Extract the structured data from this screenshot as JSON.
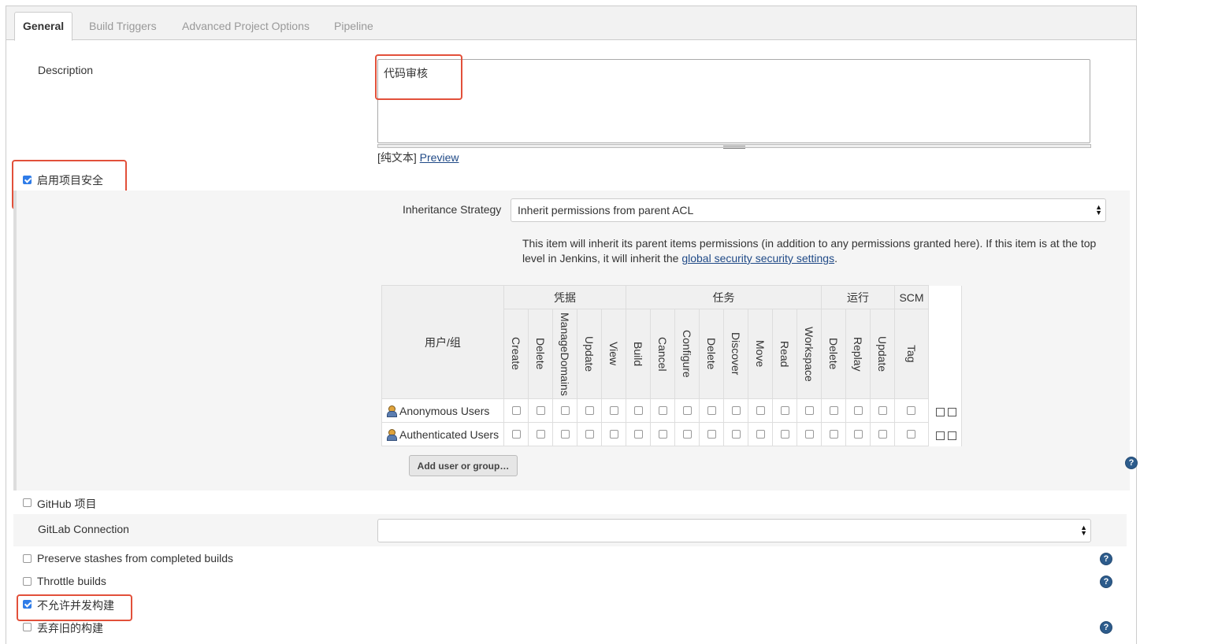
{
  "tabs": [
    {
      "label": "General",
      "active": true
    },
    {
      "label": "Build Triggers",
      "active": false
    },
    {
      "label": "Advanced Project Options",
      "active": false
    },
    {
      "label": "Pipeline",
      "active": false
    }
  ],
  "description": {
    "label": "Description",
    "value": "代码审核",
    "plain_text_label": "[纯文本]",
    "preview_link": "Preview"
  },
  "project_security": {
    "label": "启用项目安全",
    "checked": true,
    "inheritance_label": "Inheritance Strategy",
    "inheritance_value": "Inherit permissions from parent ACL",
    "help_text_1": "This item will inherit its parent items permissions (in addition to any permissions granted here). If this item is at the top",
    "help_text_2": "level in Jenkins, it will inherit the",
    "help_link": "global security security settings",
    "help_text_end": "."
  },
  "matrix": {
    "user_header": "用户/组",
    "groups": [
      {
        "name": "凭据"
      },
      {
        "name": "任务"
      },
      {
        "name": "运行"
      },
      {
        "name": "SCM"
      }
    ],
    "columns": [
      "Create",
      "Delete",
      "ManageDomains",
      "Update",
      "View",
      "Build",
      "Cancel",
      "Configure",
      "Delete",
      "Discover",
      "Move",
      "Read",
      "Workspace",
      "Delete",
      "Replay",
      "Update",
      "Tag"
    ],
    "rows": [
      {
        "name": "Anonymous Users"
      },
      {
        "name": "Authenticated Users"
      }
    ],
    "add_button": "Add user or group…"
  },
  "options": {
    "github_label": "GitHub 项目",
    "gitlab_label": "GitLab Connection",
    "gitlab_value": "",
    "preserve_label": "Preserve stashes from completed builds",
    "throttle_label": "Throttle builds",
    "no_concurrent_label": "不允许并发构建",
    "discard_label": "丢弃旧的构建"
  },
  "colors": {
    "highlight": "#e2503a",
    "link": "#204a87",
    "checkbox_checked": "#2f7ce8"
  }
}
